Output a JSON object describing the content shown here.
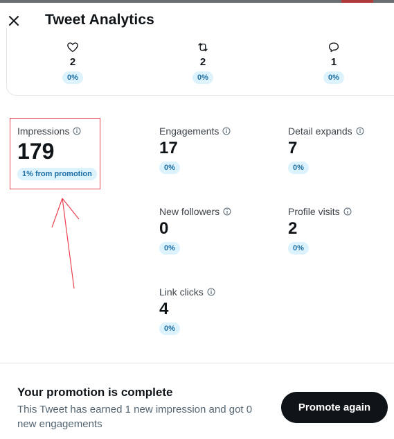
{
  "header": {
    "title": "Tweet Analytics",
    "close_icon": "close-icon"
  },
  "engagement_row": [
    {
      "icon": "heart-icon",
      "value": "2",
      "change": "0%"
    },
    {
      "icon": "retweet-icon",
      "value": "2",
      "change": "0%"
    },
    {
      "icon": "reply-icon",
      "value": "1",
      "change": "0%"
    }
  ],
  "stats": {
    "impressions": {
      "label": "Impressions",
      "value": "179",
      "badge": "1% from promotion",
      "icon": "info-icon"
    },
    "engagements": {
      "label": "Engagements",
      "value": "17",
      "change": "0%",
      "icon": "info-icon"
    },
    "detail_expands": {
      "label": "Detail expands",
      "value": "7",
      "change": "0%",
      "icon": "info-icon"
    },
    "new_followers": {
      "label": "New followers",
      "value": "0",
      "change": "0%",
      "icon": "info-icon"
    },
    "profile_visits": {
      "label": "Profile visits",
      "value": "2",
      "change": "0%",
      "icon": "info-icon"
    },
    "link_clicks": {
      "label": "Link clicks",
      "value": "4",
      "change": "0%",
      "icon": "info-icon"
    }
  },
  "promotion": {
    "title": "Your promotion is complete",
    "description": "This Tweet has earned 1 new impression and got 0 new engagements",
    "button_label": "Promote again"
  },
  "colors": {
    "text": "#0f1419",
    "muted": "#536471",
    "badge_bg": "#dcf2fd",
    "badge_text": "#1d6fa5",
    "annotation": "#e8414f"
  }
}
